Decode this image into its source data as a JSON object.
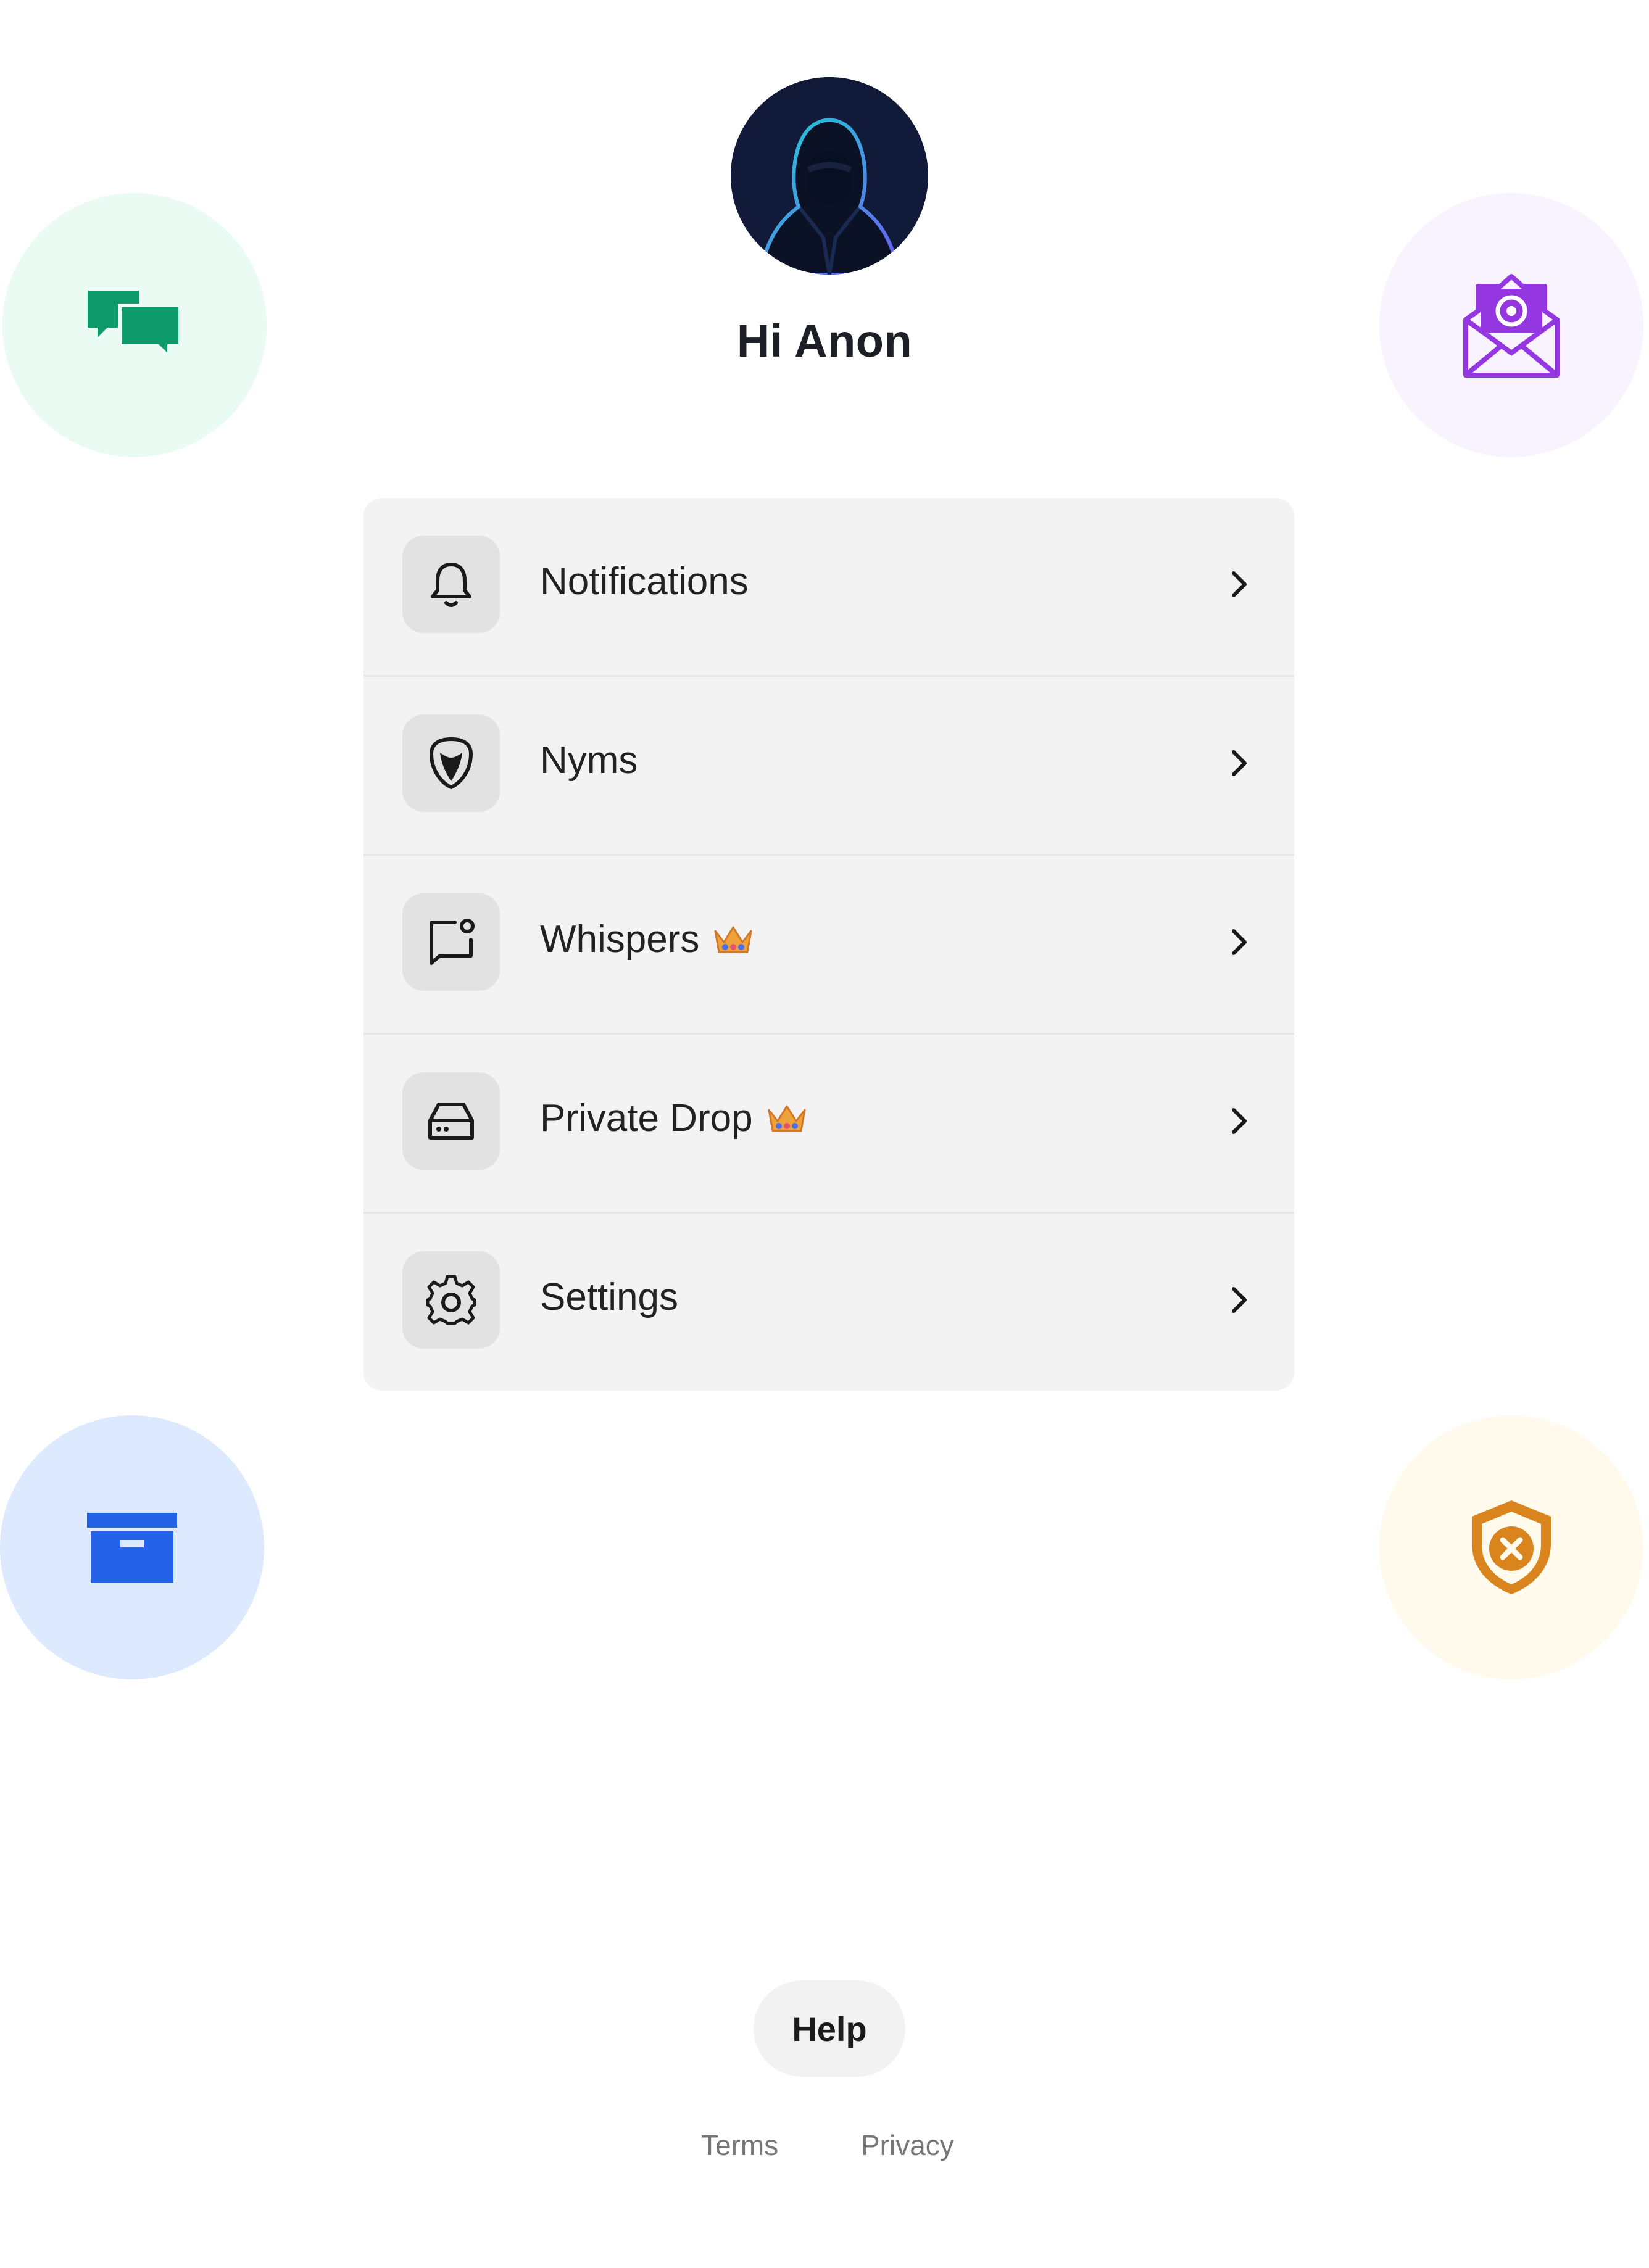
{
  "header": {
    "greeting": "Hi Anon",
    "avatar_icon": "hooded-anonymous-avatar"
  },
  "decor": {
    "top_left": {
      "icon": "chat-bubbles-icon",
      "bg": "#e9fbf3",
      "color": "#0e9a6a"
    },
    "top_right": {
      "icon": "email-at-icon",
      "bg": "#f8f3ff",
      "color": "#9437e0"
    },
    "bottom_left": {
      "icon": "archive-box-icon",
      "bg": "#dce9ff",
      "color": "#2463e8"
    },
    "bottom_right": {
      "icon": "shield-x-icon",
      "bg": "#fffaeb",
      "color": "#d9841c"
    }
  },
  "menu": {
    "items": [
      {
        "label": "Notifications",
        "icon": "bell-icon",
        "premium": false
      },
      {
        "label": "Nyms",
        "icon": "mask-shield-icon",
        "premium": false
      },
      {
        "label": "Whispers",
        "icon": "message-dot-icon",
        "premium": true
      },
      {
        "label": "Private Drop",
        "icon": "drive-icon",
        "premium": true
      },
      {
        "label": "Settings",
        "icon": "gear-icon",
        "premium": false
      }
    ]
  },
  "footer": {
    "help_label": "Help",
    "terms_label": "Terms",
    "privacy_label": "Privacy"
  }
}
